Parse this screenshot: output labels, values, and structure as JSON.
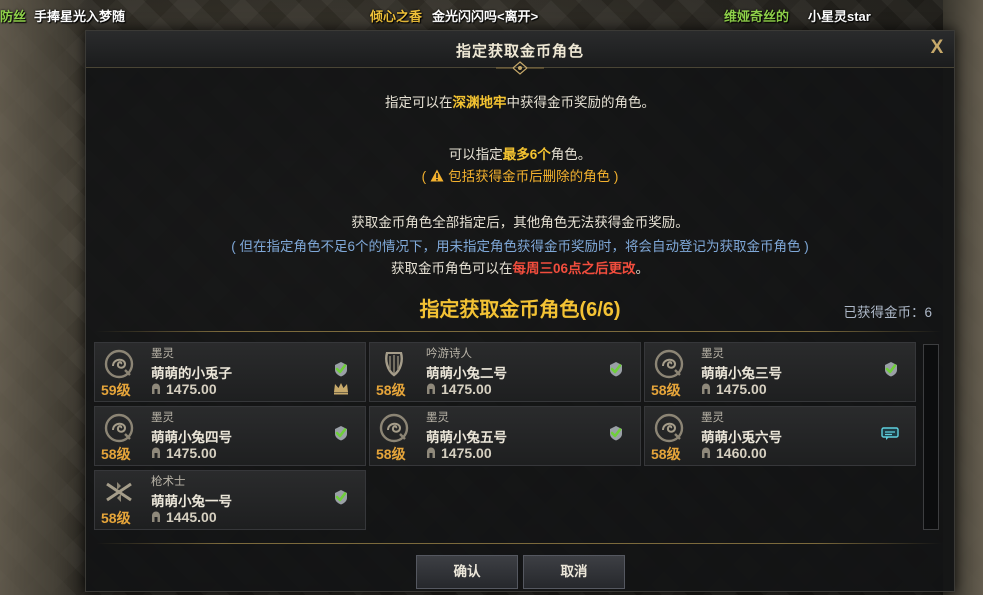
{
  "background_names": {
    "n1": "防丝",
    "n2": "手捧星光入梦随",
    "n3": "倾心之香",
    "n4": "金光闪闪吗<离开>",
    "n5": "维娅奇丝的",
    "n6": "小星灵star"
  },
  "dialog": {
    "title": "指定获取金币角色",
    "close_label": "X",
    "line1_pre": "指定可以在",
    "line1_hl": "深渊地牢",
    "line1_post": "中获得金币奖励的角色。",
    "line2_pre": "可以指定",
    "line2_hl": "最多6个",
    "line2_post": "角色。",
    "line3_open": "(",
    "line3_text": "包括获得金币后删除的角色",
    "line3_close": ")",
    "line4": "获取金币角色全部指定后，其他角色无法获得金币奖励。",
    "line5": "( 但在指定角色不足6个的情况下，用未指定角色获得金币奖励时，将会自动登记为获取金币角色 )",
    "line6_pre": "获取金币角色可以在",
    "line6_hl": "每周三06点之后更改",
    "line6_post": "。",
    "section_title": "指定获取金币角色(6/6)",
    "gold_label": "已获得金币：6",
    "confirm_label": "确认",
    "cancel_label": "取消"
  },
  "characters": [
    {
      "class": "墨灵",
      "name": "萌萌的小兎子",
      "level": "59级",
      "item_level": "1475.00",
      "status": "check",
      "main": true
    },
    {
      "class": "吟游诗人",
      "name": "萌萌小兔二号",
      "level": "58级",
      "item_level": "1475.00",
      "status": "check",
      "main": false
    },
    {
      "class": "墨灵",
      "name": "萌萌小兔三号",
      "level": "58级",
      "item_level": "1475.00",
      "status": "check",
      "main": false
    },
    {
      "class": "墨灵",
      "name": "萌萌小兔四号",
      "level": "58级",
      "item_level": "1475.00",
      "status": "check",
      "main": false
    },
    {
      "class": "墨灵",
      "name": "萌萌小兔五号",
      "level": "58级",
      "item_level": "1475.00",
      "status": "check",
      "main": false
    },
    {
      "class": "墨灵",
      "name": "萌萌小兎六号",
      "level": "58级",
      "item_level": "1460.00",
      "status": "chat",
      "main": false
    },
    {
      "class": "枪术士",
      "name": "萌萌小兔一号",
      "level": "58级",
      "item_level": "1445.00",
      "status": "check",
      "main": false
    }
  ],
  "colors": {
    "accent_gold": "#f3c234",
    "highlight_red": "#f24d3d",
    "note_blue": "#7fa8d8",
    "level_orange": "#e6a53a",
    "check_green": "#6fcf3a"
  }
}
